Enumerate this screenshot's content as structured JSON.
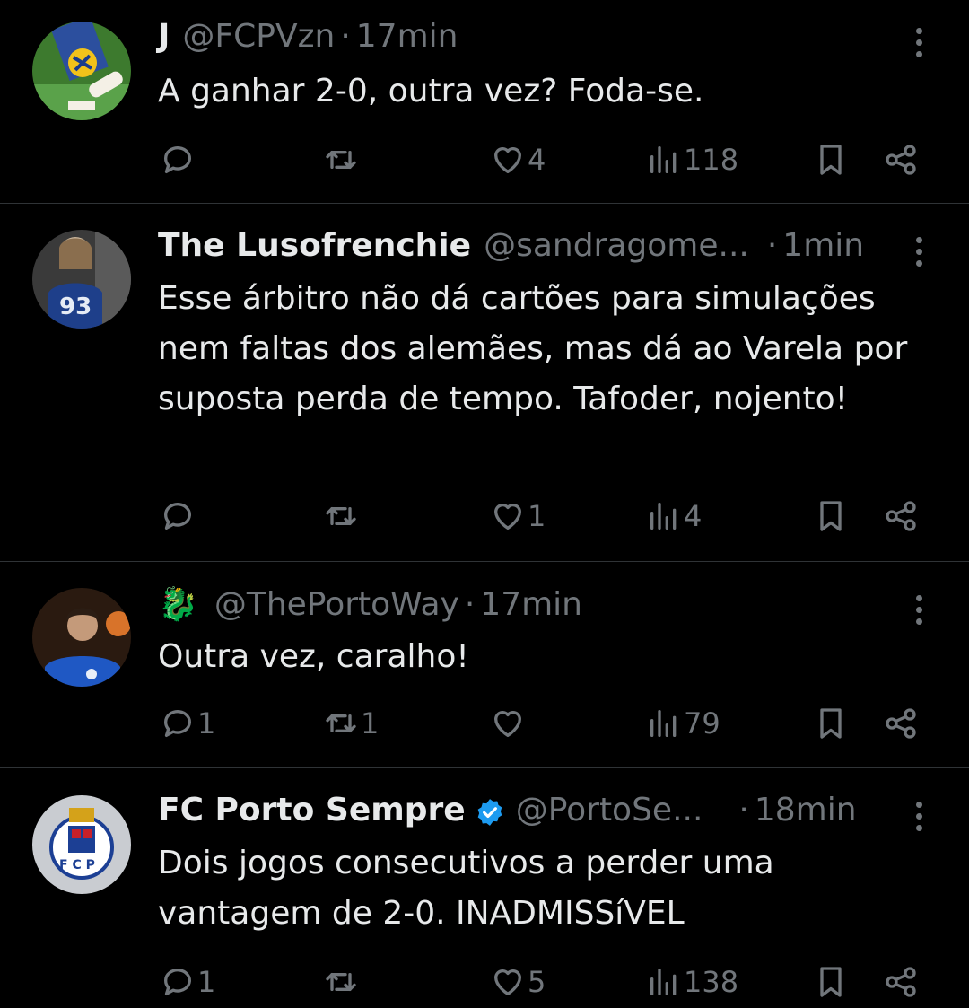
{
  "tweets": [
    {
      "name": "J",
      "handle": "@FCPVzn",
      "dot": "·",
      "time": "17min",
      "text": "A ganhar 2-0, outra vez? Foda-se.",
      "replies": "",
      "retweets": "",
      "likes": "4",
      "views": "118",
      "avatar_icon": "player-photo-avatar"
    },
    {
      "name": "The Lusofrenchie",
      "handle": "@sandragome...",
      "dot": "·",
      "time": "1min",
      "text": "Esse árbitro não dá cartões para simulações nem faltas dos alemães, mas dá ao Varela por suposta perda de tempo. Tafoder, nojento!",
      "replies": "",
      "retweets": "",
      "likes": "1",
      "views": "4",
      "avatar_icon": "jersey-93-avatar"
    },
    {
      "name": "🐉",
      "handle": "@ThePortoWay",
      "dot": "·",
      "time": "17min",
      "text": "Outra vez, caralho!",
      "replies": "1",
      "retweets": "1",
      "likes": "",
      "views": "79",
      "avatar_icon": "player-portrait-avatar"
    },
    {
      "name": "FC Porto Sempre",
      "handle": "@PortoSe...",
      "dot": "·",
      "time": "18min",
      "text": "Dois jogos consecutivos a perder uma vantagem de 2-0. INADMISSíVEL",
      "replies": "1",
      "retweets": "",
      "likes": "5",
      "views": "138",
      "avatar_icon": "fc-porto-crest-avatar",
      "verified": true
    }
  ],
  "colors": {
    "background": "#000000",
    "text": "#e7e9ea",
    "secondary": "#71767b",
    "verified": "#1d9bf0",
    "divider": "#2f3336"
  }
}
